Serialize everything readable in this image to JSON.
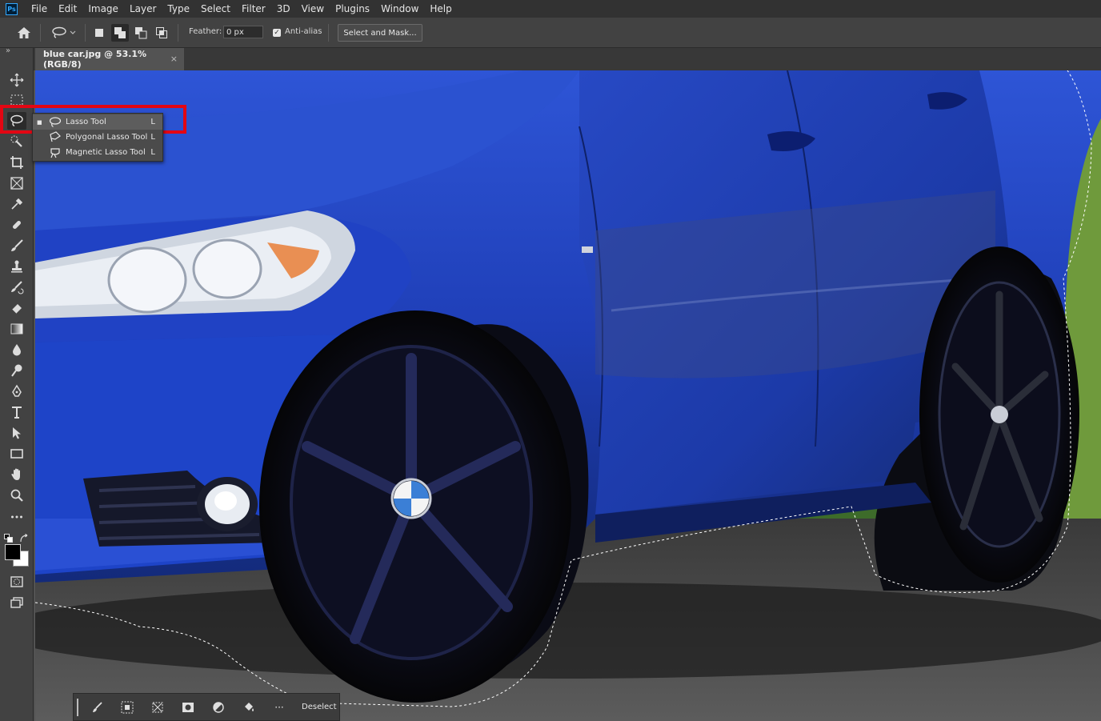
{
  "app": {
    "logo": "Ps"
  },
  "menu": [
    "File",
    "Edit",
    "Image",
    "Layer",
    "Type",
    "Select",
    "Filter",
    "3D",
    "View",
    "Plugins",
    "Window",
    "Help"
  ],
  "options": {
    "feather_label": "Feather:",
    "feather_value": "0 px",
    "antialias_label": "Anti-alias",
    "antialias_checked": true,
    "select_mask_label": "Select and Mask..."
  },
  "document": {
    "tab_title": "blue car.jpg @ 53.1% (RGB/8)",
    "close_glyph": "×"
  },
  "toolbar": {
    "collapse_glyph": "»"
  },
  "flyout": {
    "items": [
      {
        "label": "Lasso Tool",
        "key": "L",
        "active": true
      },
      {
        "label": "Polygonal Lasso Tool",
        "key": "L",
        "active": false
      },
      {
        "label": "Magnetic Lasso Tool",
        "key": "L",
        "active": false
      }
    ]
  },
  "taskbar": {
    "deselect_label": "Deselect",
    "more_glyph": "···"
  },
  "colors": {
    "highlight": "#e30613",
    "car_blue": "#1f3fb8",
    "ui_panel": "#424242"
  }
}
